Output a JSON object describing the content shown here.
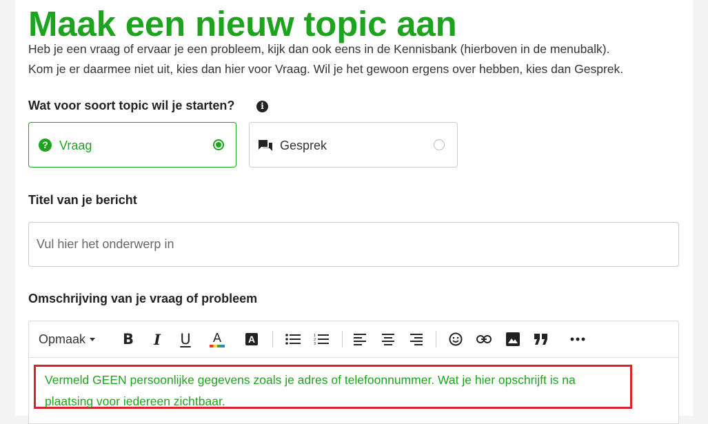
{
  "page": {
    "title": "Maak een nieuw topic aan",
    "intro_line1": "Heb je een vraag of ervaar je een probleem, kijk dan ook eens in de Kennisbank (hierboven in de menubalk).",
    "intro_line2": "Kom je er daarmee niet uit, kies dan hier voor Vraag. Wil je het gewoon ergens over hebben, kies dan Gesprek."
  },
  "topic_type": {
    "label": "Wat voor soort topic wil je starten?",
    "info_icon": "info-icon",
    "options": [
      {
        "label": "Vraag",
        "icon": "question-circle-icon",
        "selected": true
      },
      {
        "label": "Gesprek",
        "icon": "chat-icon",
        "selected": false
      }
    ]
  },
  "title_field": {
    "label": "Titel van je bericht",
    "placeholder": "Vul hier het onderwerp in",
    "value": ""
  },
  "description": {
    "label": "Omschrijving van je vraag of probleem",
    "toolbar": {
      "format_label": "Opmaak",
      "bold_glyph": "B",
      "italic_glyph": "I",
      "underline_glyph": "U",
      "font_color_glyph": "A",
      "highlight_glyph": "A",
      "buttons": [
        "bold-icon",
        "italic-icon",
        "underline-icon",
        "font-color-icon",
        "text-background-icon",
        "bulleted-list-icon",
        "numbered-list-icon",
        "align-left-icon",
        "align-center-icon",
        "align-right-icon",
        "emoji-icon",
        "link-icon",
        "image-icon",
        "quote-icon",
        "more-icon"
      ]
    },
    "notice": "Vermeld GEEN persoonlijke gegevens zoals je adres of telefoonnummer. Wat je hier opschrijft is na plaatsing voor iedereen zichtbaar."
  },
  "colors": {
    "accent": "#1ea31e",
    "warning_border": "#d9222a"
  }
}
